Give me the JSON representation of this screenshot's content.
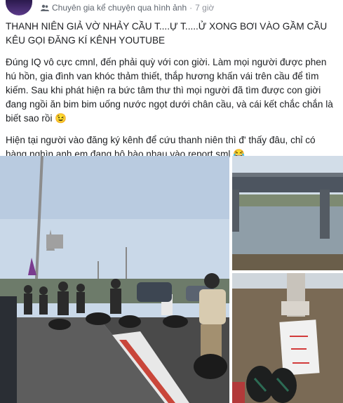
{
  "post": {
    "group_name": "Chuyên gia kể chuyện qua hình ảnh",
    "separator": "·",
    "time": "7 giờ",
    "headline": "THANH NIÊN GIẢ VỜ NHẢY CẦU T....Ự T.....Ử XONG BƠI VÀO GẦM CẦU KÊU GỌI ĐĂNG KÍ KÊNH YOUTUBE",
    "paragraph_1": "Đúng IQ vô cực cmnl, đến phải quỳ với con giời. Làm mọi người được phen hú hồn, gia đình van khóc thảm thiết, thắp hương khấn vái trên cầu để tìm kiếm. Sau khi phát hiện ra bức tâm thư thì mọi người đã tìm được con giời đang ngồi ăn bim bim uống nước ngọt dưới chân cầu, và cái kết chắc chắn là biết sao rồi 😉",
    "paragraph_2": "Hiện tại người vào đăng ký kênh để cứu thanh niên thì đ' thấy đâu, chỉ có hàng nghìn anh em đang hô hào nhau vào report sml 😂"
  },
  "colors": {
    "text": "#1c1e21",
    "meta": "#606770",
    "sky": "#c9d8e8",
    "river": "#8a9aa6"
  },
  "icons": [
    "group-icon"
  ]
}
